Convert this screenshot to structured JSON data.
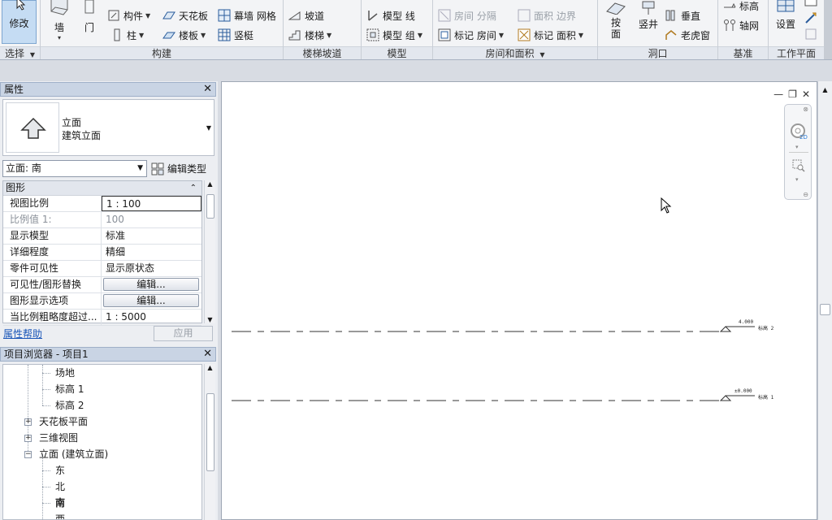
{
  "ribbon": {
    "panels": {
      "select": "选择",
      "build": "构建",
      "circulation": "楼梯坡道",
      "model": "模型",
      "room_area": "房间和面积",
      "opening": "洞口",
      "datum": "基准",
      "workplane": "工作平面"
    },
    "modify": "修改",
    "wall": "墙",
    "door": "门",
    "component": "构件",
    "column": "柱",
    "ceiling": "天花板",
    "floor": "楼板",
    "curtain_grid": "幕墙 网格",
    "mullion": "竖梃",
    "ramp": "坡道",
    "stair": "楼梯",
    "model_line": "模型 线",
    "model_group": "模型 组",
    "room": "房间",
    "room_separator": "分隔",
    "area": "面积",
    "area_boundary": "边界",
    "tag_room": "标记",
    "tag_room2": "房间",
    "tag_area": "标记",
    "tag_area2": "面积",
    "by_face": "按\n面",
    "by_face_l1": "按",
    "by_face_l2": "面",
    "shaft": "竖井",
    "vertical": "垂直",
    "dormer": "老虎窗",
    "level": "标高",
    "grid": "轴网",
    "set": "设置"
  },
  "properties": {
    "title": "属性",
    "type_name_1": "立面",
    "type_name_2": "建筑立面",
    "instance_selector": "立面: 南",
    "edit_type": "编辑类型",
    "group": "图形",
    "rows": [
      {
        "key": "视图比例",
        "value": "1 : 100"
      },
      {
        "key": "比例值 1:",
        "value": "100"
      },
      {
        "key": "显示模型",
        "value": "标准"
      },
      {
        "key": "详细程度",
        "value": "精细"
      },
      {
        "key": "零件可见性",
        "value": "显示原状态"
      },
      {
        "key": "可见性/图形替换",
        "value": "编辑..."
      },
      {
        "key": "图形显示选项",
        "value": "编辑..."
      },
      {
        "key": "当比例粗略度超过...",
        "value": "1 : 5000"
      }
    ],
    "help": "属性帮助",
    "apply": "应用"
  },
  "browser": {
    "title": "项目浏览器 - 项目1",
    "items": [
      "场地",
      "标高 1",
      "标高 2",
      "天花板平面",
      "三维视图",
      "立面 (建筑立面)",
      "东",
      "北",
      "南",
      "西"
    ]
  },
  "canvas": {
    "level_2_elev": "4.000",
    "level_2_name": "标高 2",
    "level_1_elev": "±0.000",
    "level_1_name": "标高 1"
  },
  "colors": {
    "accent": "#c5dcf3",
    "title_bar": "#c9d4e4",
    "link": "#1a56b8"
  }
}
